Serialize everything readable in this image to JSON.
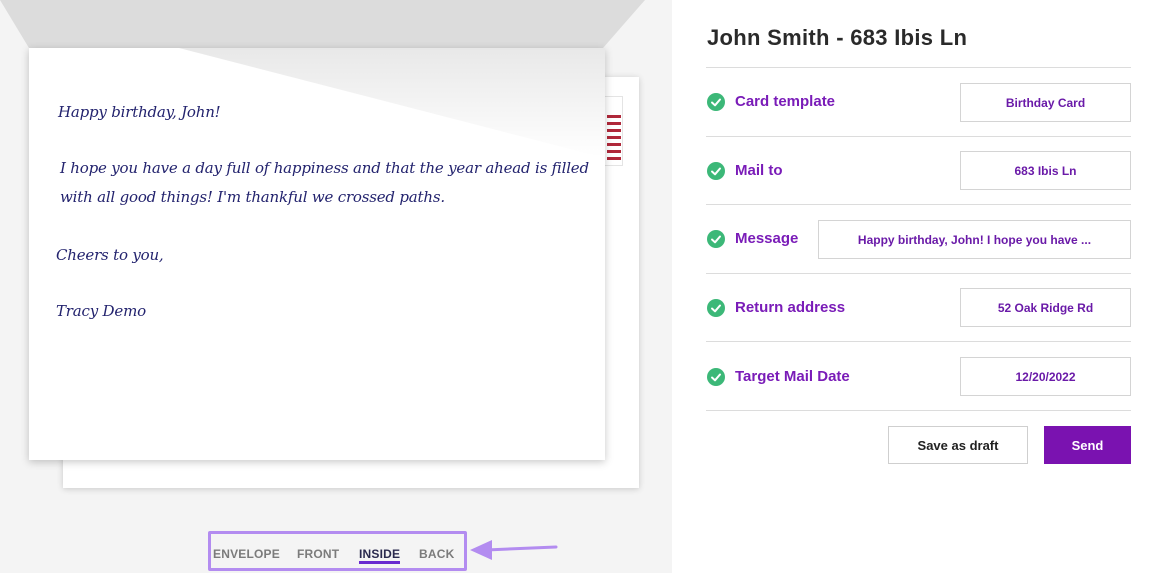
{
  "card": {
    "greeting": "Happy birthday, John!",
    "body_line1": "I hope you have a day full of happiness and that the year ahead is filled",
    "body_line2": "with all good things! I'm thankful we crossed paths.",
    "closing": "Cheers to you,",
    "signature": "Tracy Demo"
  },
  "view_tabs": [
    {
      "label": "ENVELOPE"
    },
    {
      "label": "FRONT"
    },
    {
      "label": "INSIDE"
    },
    {
      "label": "BACK"
    }
  ],
  "active_tab": "INSIDE",
  "form": {
    "title": "John Smith - 683 Ibis Ln",
    "rows": [
      {
        "label": "Card template",
        "value": "Birthday Card",
        "status_icon": "check-circle-icon"
      },
      {
        "label": "Mail to",
        "value": "683 Ibis Ln",
        "status_icon": "check-circle-icon"
      },
      {
        "label": "Message",
        "value": "Happy birthday, John! I hope you have ...",
        "status_icon": "check-circle-icon"
      },
      {
        "label": "Return address",
        "value": "52 Oak Ridge Rd",
        "status_icon": "check-circle-icon"
      },
      {
        "label": "Target Mail Date",
        "value": "12/20/2022",
        "status_icon": "check-circle-icon"
      }
    ],
    "draft_label": "Save as draft",
    "send_label": "Send"
  },
  "colors": {
    "accent": "#7a12b0",
    "label": "#7a1cb8",
    "check": "#3cb878",
    "highlight": "#b38cf0",
    "handwriting": "#23236e"
  }
}
